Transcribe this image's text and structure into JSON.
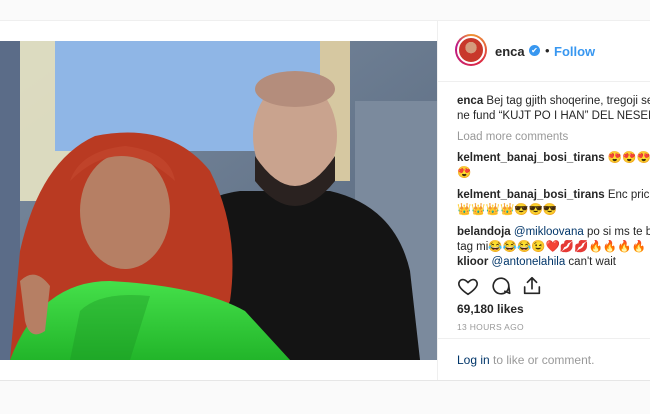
{
  "post": {
    "username": "enca",
    "verified_mark": "✔",
    "dot": "•",
    "follow_label": "Follow",
    "caption_text_1": "Bej tag gjith shoqerine, tregoji se ne",
    "caption_text_2": "ne fund “KUJT PO I HAN” DEL NESEEEEEE",
    "load_more": "Load more comments",
    "comments": [
      {
        "user": "kelment_banaj_bosi_tirans",
        "text": "😍😍😍😍"
      },
      {
        "user": "",
        "text": "😍"
      },
      {
        "user": "kelment_banaj_bosi_tirans",
        "text": "Enc pricnsha"
      },
      {
        "user": "",
        "text": "👑👑👑👑😎😎😎"
      },
      {
        "user": "belandoja",
        "mention": "@mikloovana",
        "text": "po si ms te bej"
      },
      {
        "user": "",
        "text": "tag mi😂😂😂😉❤️💋💋🔥🔥🔥🔥"
      },
      {
        "user": "klioor",
        "mention": "@antonelahila",
        "text": "can't wait"
      }
    ],
    "likes": "69,180 likes",
    "timestamp": "13 HOURS AGO",
    "login_link": "Log in",
    "login_suffix": " to like or comment."
  },
  "icons": {
    "like": "heart-icon",
    "comment": "comment-icon",
    "share": "share-icon"
  },
  "colors": {
    "link": "#3897f0",
    "text": "#262626",
    "muted": "#999999"
  }
}
